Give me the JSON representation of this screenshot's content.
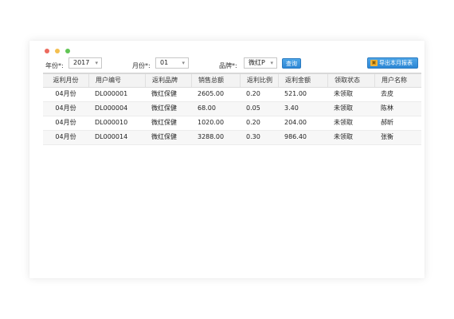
{
  "toolbar": {
    "year_label": "年份*:",
    "year_value": "2017",
    "month_label": "月份*:",
    "month_value": "01",
    "brand_label": "品牌*:",
    "brand_value": "微红P",
    "query_label": "查询",
    "export_label": "导出本月报表"
  },
  "table": {
    "headers": [
      "返利月份",
      "用户编号",
      "返利品牌",
      "销售总额",
      "返利比例",
      "返利金额",
      "领取状态",
      "用户名称"
    ],
    "rows": [
      [
        "04月份",
        "DL000001",
        "微红保健",
        "2605.00",
        "0.20",
        "521.00",
        "未领取",
        "去皮"
      ],
      [
        "04月份",
        "DL000004",
        "微红保健",
        "68.00",
        "0.05",
        "3.40",
        "未领取",
        "陈林"
      ],
      [
        "04月份",
        "DL000010",
        "微红保健",
        "1020.00",
        "0.20",
        "204.00",
        "未领取",
        "郝昕"
      ],
      [
        "04月份",
        "DL000014",
        "微红保健",
        "3288.00",
        "0.30",
        "986.40",
        "未领取",
        "张衡"
      ]
    ]
  }
}
